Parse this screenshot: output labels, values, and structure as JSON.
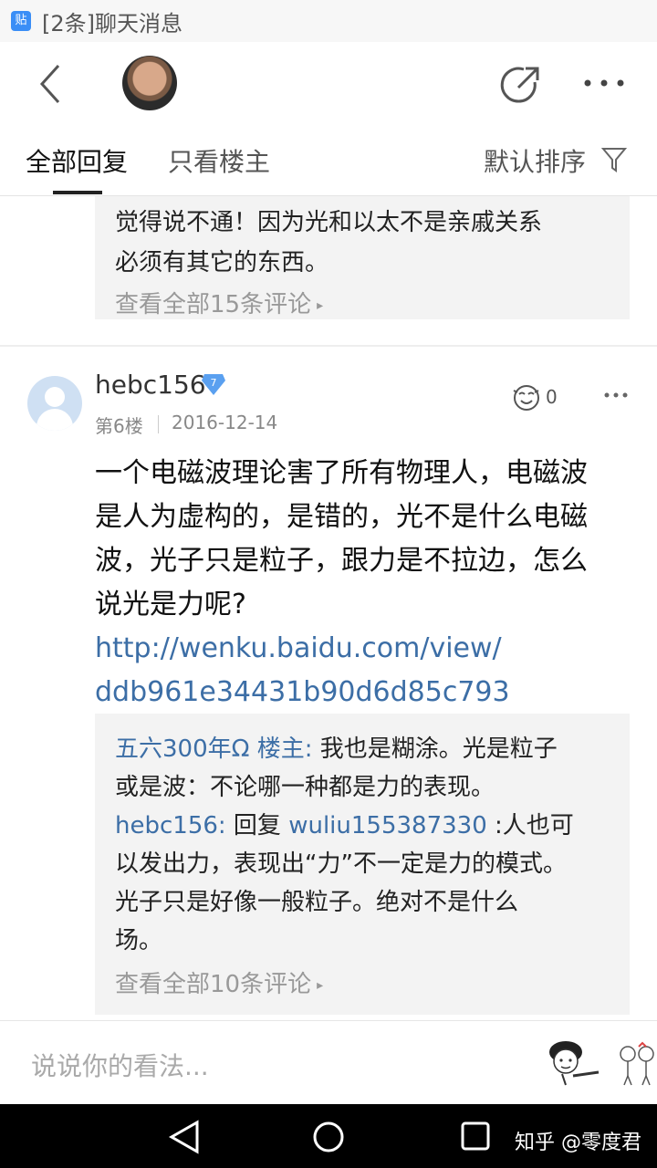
{
  "status_bar": {
    "app_icon": "贴",
    "title": "[2条]聊天消息"
  },
  "tabs": {
    "all": "全部回复",
    "owner_only": "只看楼主",
    "sort": "默认排序"
  },
  "prev_comment": {
    "line1": "觉得说不通！因为光和以太不是亲戚关系",
    "line2": "必须有其它的东西。",
    "view_more": "查看全部15条评论"
  },
  "post": {
    "username": "hebc156",
    "level": "7",
    "floor": "第6楼",
    "date": "2016-12-14",
    "likes": "0",
    "body_lines": [
      "一个电磁波理论害了所有物理人，电磁波",
      "是人为虚构的，是错的，光不是什么电磁",
      "波，光子只是粒子，跟力是不拉边，怎么",
      "说光是力呢?"
    ],
    "link_lines": [
      "http://wenku.baidu.com/view/",
      "ddb961e34431b90d6d85c793"
    ],
    "comments": {
      "c1_author": "五六300年Ω 楼主:",
      "c1_line1": " 我也是糊涂。光是粒子",
      "c1_line2": "或是波：不论哪一种都是力的表现。",
      "c2_author": "hebc156:",
      "c2_reply": " 回复 ",
      "c2_target": "wuliu155387330",
      "c2_line1": " :人也可",
      "c2_line2": "以发出力，表现出“力”不一定是力的模式。",
      "c2_line3": "光子只是好像一般粒子。绝对不是什么",
      "c2_line4": "场。",
      "view_more": "查看全部10条评论"
    }
  },
  "input": {
    "placeholder": "说说你的看法..."
  },
  "watermark": "知乎 @零度君",
  "icons": {
    "back": "back-arrow-icon",
    "share": "share-icon",
    "more": "more-icon",
    "filter": "filter-icon",
    "level": "diamond-badge-icon",
    "like": "like-face-icon"
  },
  "colors": {
    "link": "#3c6ea6",
    "comment_bg": "#f3f3f3",
    "muted": "#999999"
  }
}
